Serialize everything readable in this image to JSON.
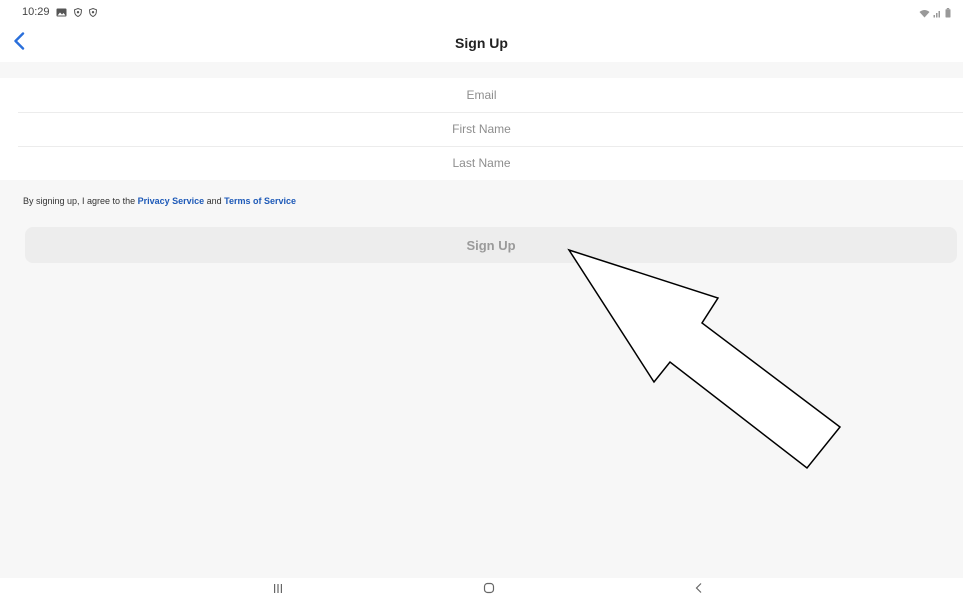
{
  "status_bar": {
    "time": "10:29",
    "left_icons": [
      "gallery-icon",
      "shield-icon",
      "shield-icon"
    ],
    "right_icons": [
      "wifi-icon",
      "signal-icon",
      "battery-icon"
    ]
  },
  "header": {
    "title": "Sign Up",
    "back_icon": "chevron-left-icon"
  },
  "form": {
    "email_placeholder": "Email",
    "first_name_placeholder": "First Name",
    "last_name_placeholder": "Last Name"
  },
  "agreement": {
    "prefix": "By signing up, I agree to the ",
    "privacy_link": "Privacy Service",
    "conjunction": " and ",
    "terms_link": "Terms of Service"
  },
  "signup_button_label": "Sign Up",
  "nav_bar": {
    "items": [
      "recent-apps-icon",
      "home-icon",
      "back-icon"
    ]
  },
  "colors": {
    "link": "#1e5ab8",
    "back_chevron": "#2a6fdb",
    "background": "#f7f7f7"
  }
}
